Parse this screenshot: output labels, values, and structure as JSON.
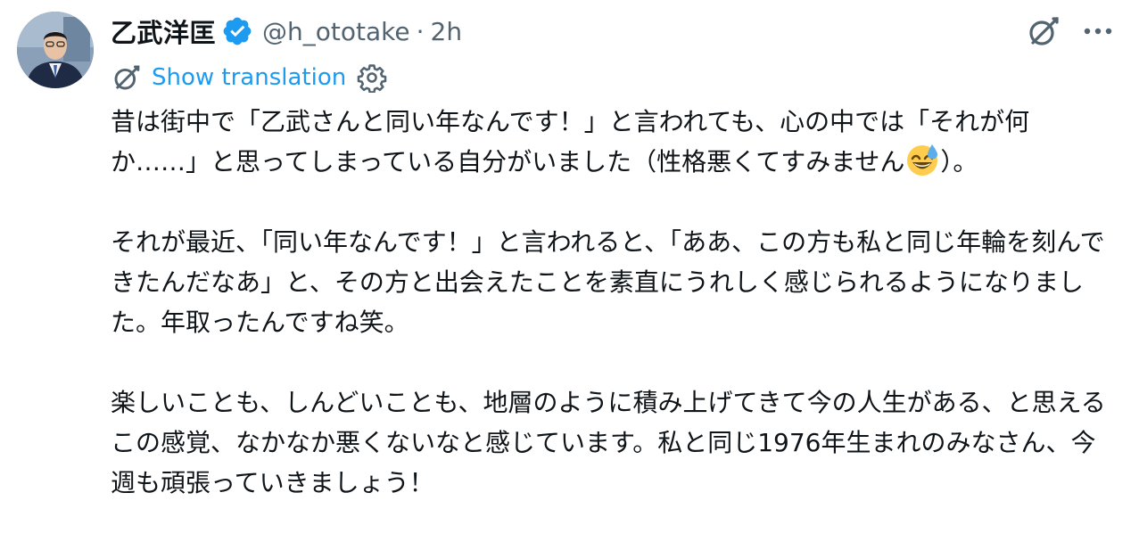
{
  "author": {
    "display_name": "乙武洋匡",
    "handle": "@h_ototake",
    "separator": "·",
    "time": "2h",
    "avatar_icon": "profile-photo",
    "verified_icon": "verified-badge-icon",
    "verified_color": "#1d9bf0"
  },
  "actions": {
    "grok_icon": "grok-icon",
    "more_icon": "more-options-icon"
  },
  "translation": {
    "label": "Show translation",
    "icon": "grok-icon",
    "settings_icon": "gear-icon",
    "link_color": "#1d9bf0"
  },
  "body": {
    "paragraph_1_part_1": "昔は街中で「乙武さんと同い年なんです！」と言われても、心の中では「それが何か……」と思ってしまっている自分がいました（性格悪くてすみません",
    "paragraph_1_emoji": "grinning-sweat-emoji",
    "paragraph_1_part_2": "）。",
    "paragraph_2": "それが最近、「同い年なんです！」と言われると、「ああ、この方も私と同じ年輪を刻んできたんだなあ」と、その方と出会えたことを素直にうれしく感じられるようになりました。年取ったんですね笑。",
    "paragraph_3": "楽しいことも、しんどいことも、地層のように積み上げてきて今の人生がある、と思えるこの感覚、なかなか悪くないなと感じています。私と同じ1976年生まれのみなさん、今週も頑張っていきましょう！"
  },
  "colors": {
    "text_primary": "#0f1419",
    "text_secondary": "#536471",
    "accent": "#1d9bf0"
  }
}
